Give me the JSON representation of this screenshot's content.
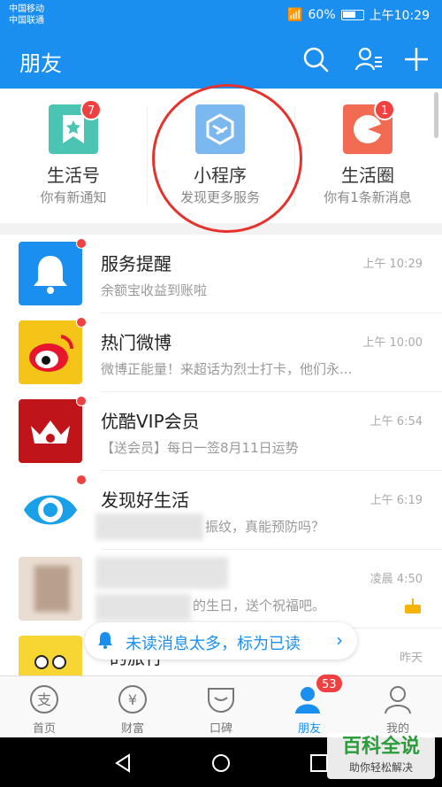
{
  "status_bar": {
    "carrier1": "中国移动",
    "carrier2": "中国联通",
    "battery": "60%",
    "time": "上午10:29"
  },
  "header": {
    "title": "朋友"
  },
  "quick": [
    {
      "title": "生活号",
      "subtitle": "你有新通知",
      "badge": "7",
      "color": "#4cc4b4"
    },
    {
      "title": "小程序",
      "subtitle": "发现更多服务",
      "badge": "",
      "color": "#7bb8f0"
    },
    {
      "title": "生活圈",
      "subtitle": "你有1条新消息",
      "badge": "1",
      "color": "#f06b52"
    }
  ],
  "messages": [
    {
      "title": "服务提醒",
      "subtitle": "余额宝收益到账啦",
      "time": "上午 10:29",
      "icon": "bell-icon"
    },
    {
      "title": "热门微博",
      "subtitle": "微博正能量！来超话为烈士打卡，他们永...",
      "time": "上午 10:00",
      "icon": "weibo-icon"
    },
    {
      "title": "优酷VIP会员",
      "subtitle": "【送会员】每日一签8月11日运势",
      "time": "上午 6:54",
      "icon": "youku-icon"
    },
    {
      "title": "发现好生活",
      "subtitle": "振纹，真能预防吗？",
      "time": "上午 6:19",
      "icon": "eye-icon"
    },
    {
      "title": "",
      "subtitle": "的生日，送个祝福吧。",
      "time": "凌晨 4:50",
      "icon": "cake-icon"
    },
    {
      "title": "的旅行",
      "subtitle": "",
      "time": "昨天",
      "icon": "cartoon-icon"
    }
  ],
  "unread_pill": {
    "text": "未读消息太多，标为已读"
  },
  "tabs": [
    {
      "label": "首页",
      "badge": ""
    },
    {
      "label": "财富",
      "badge": ""
    },
    {
      "label": "口碑",
      "badge": ""
    },
    {
      "label": "朋友",
      "badge": "53"
    },
    {
      "label": "我的",
      "badge": ""
    }
  ],
  "watermark": {
    "title": "百科全说",
    "subtitle": "助你轻松解决"
  },
  "colors": {
    "primary": "#1a8ff0",
    "badge": "#f04040",
    "highlight": "#e5322d"
  }
}
